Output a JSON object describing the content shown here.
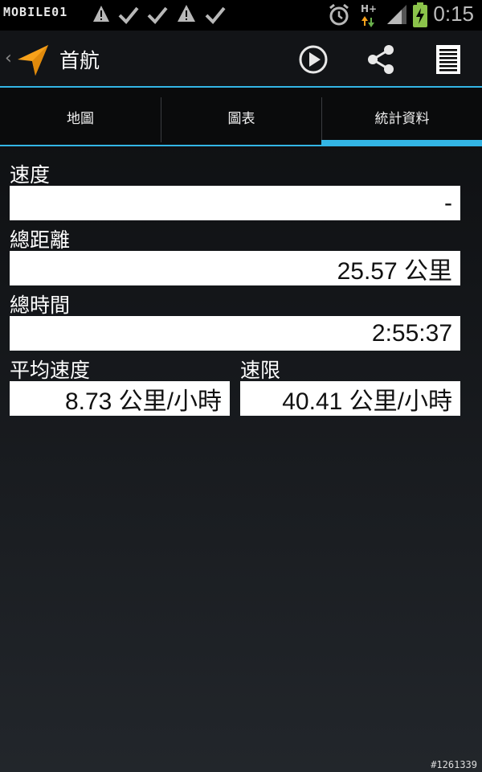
{
  "status_bar": {
    "watermark": "MOBILE01",
    "network": "H+",
    "time": "0:15",
    "icons": [
      "gps-icon",
      "image-icon",
      "warning-icon",
      "check-icon",
      "check-icon",
      "warning-icon",
      "check-icon",
      "alarm-icon",
      "signal-icon",
      "battery-charging-icon"
    ]
  },
  "action_bar": {
    "title": "首航",
    "actions": [
      "play-icon",
      "share-icon",
      "list-icon"
    ]
  },
  "tabs": [
    {
      "label": "地圖",
      "selected": false
    },
    {
      "label": "圖表",
      "selected": false
    },
    {
      "label": "統計資料",
      "selected": true
    }
  ],
  "stats": {
    "speed": {
      "label": "速度",
      "value": "-"
    },
    "total_distance": {
      "label": "總距離",
      "value": "25.57 公里"
    },
    "total_time": {
      "label": "總時間",
      "value": "2:55:37"
    },
    "average_speed": {
      "label": "平均速度",
      "value": "8.73 公里/小時"
    },
    "speed_limit": {
      "label": "速限",
      "value": "40.41 公里/小時"
    }
  },
  "footer": {
    "id": "#1261339"
  },
  "colors": {
    "accent": "#33b5e5",
    "app_icon": "#f7a11a",
    "background": "#121417"
  }
}
